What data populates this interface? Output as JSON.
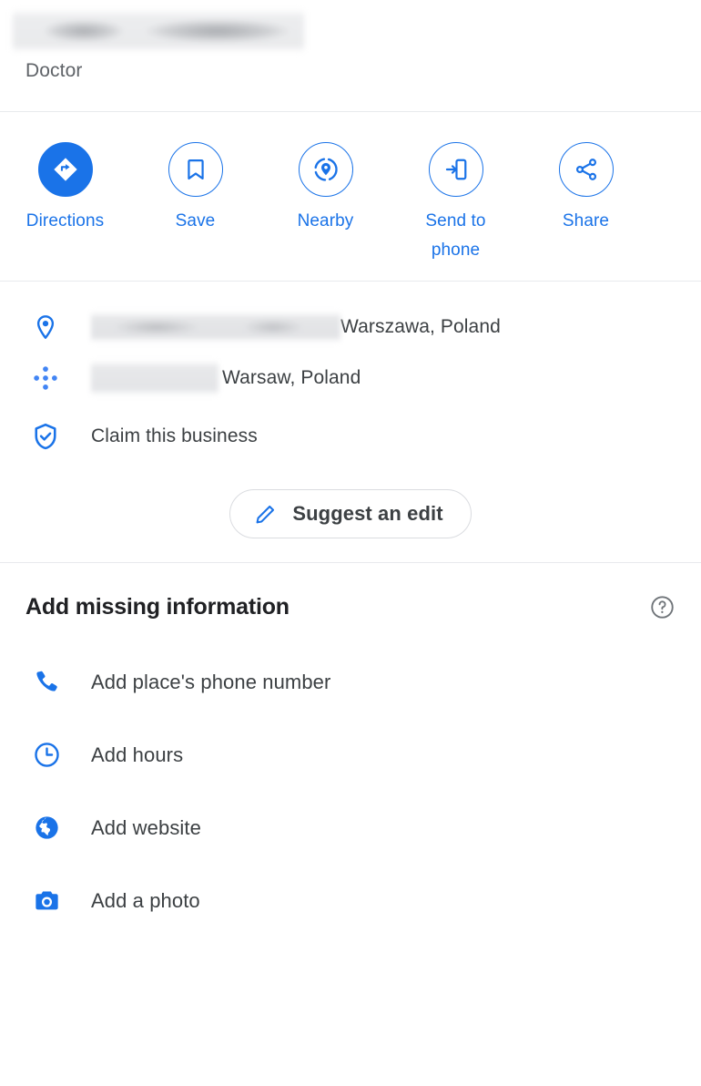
{
  "place": {
    "name_redacted": true,
    "category": "Doctor"
  },
  "actions": [
    {
      "label": "Directions",
      "icon": "directions-icon",
      "style": "filled"
    },
    {
      "label": "Save",
      "icon": "bookmark-icon",
      "style": "outlined"
    },
    {
      "label": "Nearby",
      "icon": "nearby-search-icon",
      "style": "outlined"
    },
    {
      "label": "Send to phone",
      "icon": "send-to-phone-icon",
      "style": "outlined"
    },
    {
      "label": "Share",
      "icon": "share-icon",
      "style": "outlined"
    }
  ],
  "info_rows": [
    {
      "icon": "location-pin-icon",
      "redacted": true,
      "redacted_kind": "address",
      "text": "Warszawa, Poland"
    },
    {
      "icon": "plus-code-icon",
      "redacted": true,
      "redacted_kind": "pluscode",
      "text": "Warsaw, Poland"
    },
    {
      "icon": "shield-check-icon",
      "redacted": false,
      "text": "Claim this business"
    }
  ],
  "suggest_edit": {
    "label": "Suggest an edit",
    "icon": "pencil-icon"
  },
  "add_missing_information": {
    "title": "Add missing information",
    "help_icon": "help-circle-icon",
    "items": [
      {
        "label": "Add place's phone number",
        "icon": "phone-icon"
      },
      {
        "label": "Add hours",
        "icon": "clock-icon"
      },
      {
        "label": "Add website",
        "icon": "globe-icon"
      },
      {
        "label": "Add a photo",
        "icon": "camera-icon"
      }
    ]
  },
  "colors": {
    "accent": "#1a73e8",
    "text_primary": "#3c4043",
    "text_secondary": "#5f6368",
    "divider": "#e8eaed",
    "help_icon": "#70757a"
  }
}
